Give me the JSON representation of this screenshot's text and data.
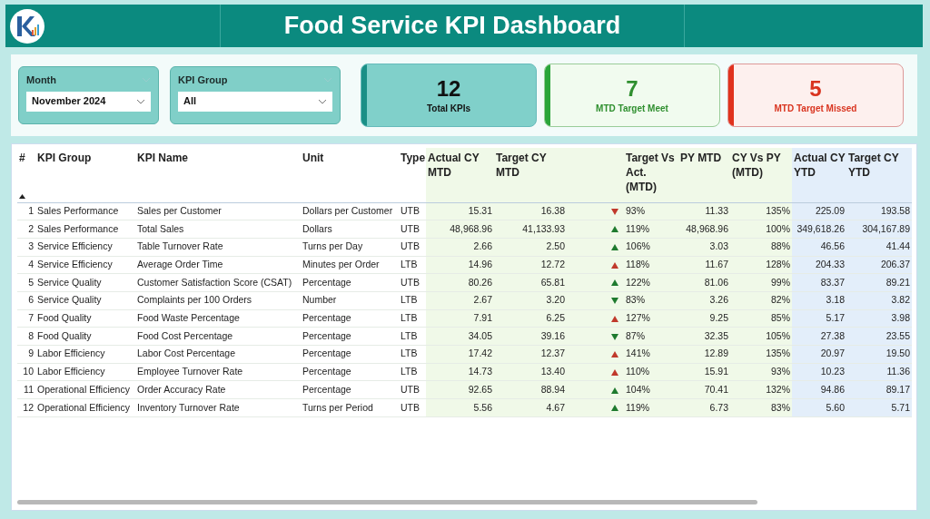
{
  "header": {
    "title": "Food Service KPI Dashboard"
  },
  "filters": [
    {
      "label": "Month",
      "value": "November 2024"
    },
    {
      "label": "KPI Group",
      "value": "All"
    }
  ],
  "cards": [
    {
      "kind": "total",
      "value": "12",
      "label": "Total KPIs"
    },
    {
      "kind": "met",
      "value": "7",
      "label": "MTD Target Meet"
    },
    {
      "kind": "missed",
      "value": "5",
      "label": "MTD Target Missed"
    }
  ],
  "table": {
    "columns": [
      "#",
      "KPI Group",
      "KPI Name",
      "Unit",
      "Type",
      "Actual CY MTD",
      "Target CY MTD",
      "Target Vs Act. (MTD)",
      "PY MTD",
      "CY Vs PY (MTD)",
      "Actual CY YTD",
      "Target CY YTD"
    ],
    "rows": [
      {
        "num": "1",
        "group": "Sales Performance",
        "name": "Sales per Customer",
        "unit": "Dollars per Customer",
        "type": "UTB",
        "actual_mtd": "15.31",
        "target_mtd": "16.38",
        "rising": false,
        "color": "#c0392b",
        "target_vs_act": "93%",
        "py_mtd": "11.33",
        "cy_vs_py": "135%",
        "actual_ytd": "225.09",
        "target_ytd": "193.58"
      },
      {
        "num": "2",
        "group": "Sales Performance",
        "name": "Total Sales",
        "unit": "Dollars",
        "type": "UTB",
        "actual_mtd": "48,968.96",
        "target_mtd": "41,133.93",
        "rising": true,
        "color": "#1e7a2e",
        "target_vs_act": "119%",
        "py_mtd": "48,968.96",
        "cy_vs_py": "100%",
        "actual_ytd": "349,618.26",
        "target_ytd": "304,167.89"
      },
      {
        "num": "3",
        "group": "Service Efficiency",
        "name": "Table Turnover Rate",
        "unit": "Turns per Day",
        "type": "UTB",
        "actual_mtd": "2.66",
        "target_mtd": "2.50",
        "rising": true,
        "color": "#1e7a2e",
        "target_vs_act": "106%",
        "py_mtd": "3.03",
        "cy_vs_py": "88%",
        "actual_ytd": "46.56",
        "target_ytd": "41.44"
      },
      {
        "num": "4",
        "group": "Service Efficiency",
        "name": "Average Order Time",
        "unit": "Minutes per Order",
        "type": "LTB",
        "actual_mtd": "14.96",
        "target_mtd": "12.72",
        "rising": true,
        "color": "#c0392b",
        "target_vs_act": "118%",
        "py_mtd": "11.67",
        "cy_vs_py": "128%",
        "actual_ytd": "204.33",
        "target_ytd": "206.37"
      },
      {
        "num": "5",
        "group": "Service Quality",
        "name": "Customer Satisfaction Score (CSAT)",
        "unit": "Percentage",
        "type": "UTB",
        "actual_mtd": "80.26",
        "target_mtd": "65.81",
        "rising": true,
        "color": "#1e7a2e",
        "target_vs_act": "122%",
        "py_mtd": "81.06",
        "cy_vs_py": "99%",
        "actual_ytd": "83.37",
        "target_ytd": "89.21"
      },
      {
        "num": "6",
        "group": "Service Quality",
        "name": "Complaints per 100 Orders",
        "unit": "Number",
        "type": "LTB",
        "actual_mtd": "2.67",
        "target_mtd": "3.20",
        "rising": false,
        "color": "#1e7a2e",
        "target_vs_act": "83%",
        "py_mtd": "3.26",
        "cy_vs_py": "82%",
        "actual_ytd": "3.18",
        "target_ytd": "3.82"
      },
      {
        "num": "7",
        "group": "Food Quality",
        "name": "Food Waste Percentage",
        "unit": "Percentage",
        "type": "LTB",
        "actual_mtd": "7.91",
        "target_mtd": "6.25",
        "rising": true,
        "color": "#c0392b",
        "target_vs_act": "127%",
        "py_mtd": "9.25",
        "cy_vs_py": "85%",
        "actual_ytd": "5.17",
        "target_ytd": "3.98"
      },
      {
        "num": "8",
        "group": "Food Quality",
        "name": "Food Cost Percentage",
        "unit": "Percentage",
        "type": "LTB",
        "actual_mtd": "34.05",
        "target_mtd": "39.16",
        "rising": false,
        "color": "#1e7a2e",
        "target_vs_act": "87%",
        "py_mtd": "32.35",
        "cy_vs_py": "105%",
        "actual_ytd": "27.38",
        "target_ytd": "23.55"
      },
      {
        "num": "9",
        "group": "Labor Efficiency",
        "name": "Labor Cost Percentage",
        "unit": "Percentage",
        "type": "LTB",
        "actual_mtd": "17.42",
        "target_mtd": "12.37",
        "rising": true,
        "color": "#c0392b",
        "target_vs_act": "141%",
        "py_mtd": "12.89",
        "cy_vs_py": "135%",
        "actual_ytd": "20.97",
        "target_ytd": "19.50"
      },
      {
        "num": "10",
        "group": "Labor Efficiency",
        "name": "Employee Turnover Rate",
        "unit": "Percentage",
        "type": "LTB",
        "actual_mtd": "14.73",
        "target_mtd": "13.40",
        "rising": true,
        "color": "#c0392b",
        "target_vs_act": "110%",
        "py_mtd": "15.91",
        "cy_vs_py": "93%",
        "actual_ytd": "10.23",
        "target_ytd": "11.36"
      },
      {
        "num": "11",
        "group": "Operational Efficiency",
        "name": "Order Accuracy Rate",
        "unit": "Percentage",
        "type": "UTB",
        "actual_mtd": "92.65",
        "target_mtd": "88.94",
        "rising": true,
        "color": "#1e7a2e",
        "target_vs_act": "104%",
        "py_mtd": "70.41",
        "cy_vs_py": "132%",
        "actual_ytd": "94.86",
        "target_ytd": "89.17"
      },
      {
        "num": "12",
        "group": "Operational Efficiency",
        "name": "Inventory Turnover Rate",
        "unit": "Turns per Period",
        "type": "UTB",
        "actual_mtd": "5.56",
        "target_mtd": "4.67",
        "rising": true,
        "color": "#1e7a2e",
        "target_vs_act": "119%",
        "py_mtd": "6.73",
        "cy_vs_py": "83%",
        "actual_ytd": "5.60",
        "target_ytd": "5.71"
      }
    ]
  }
}
